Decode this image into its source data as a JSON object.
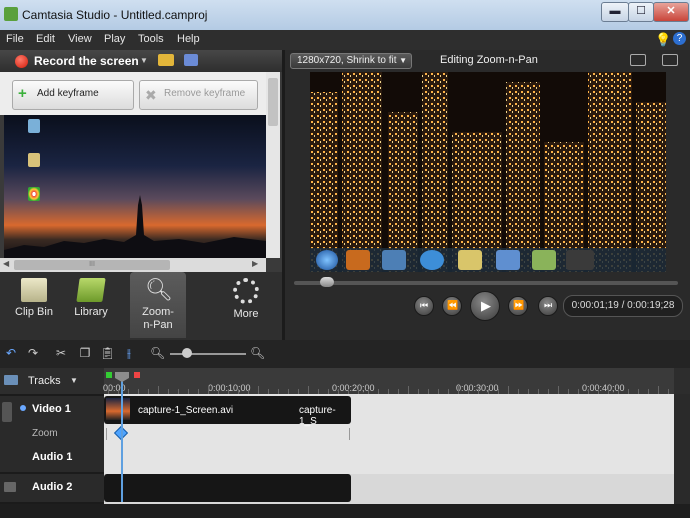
{
  "window": {
    "title": "Camtasia Studio - Untitled.camproj",
    "min_label": "▬",
    "max_label": "☐",
    "close_label": "✕"
  },
  "menu": [
    "File",
    "Edit",
    "View",
    "Play",
    "Tools",
    "Help"
  ],
  "left": {
    "record_label": "Record the screen",
    "add_keyframe": "Add keyframe",
    "remove_keyframe": "Remove keyframe",
    "scroll_grip": "III",
    "tabs": [
      "Clip Bin",
      "Library",
      "Zoom-n-Pan",
      "More"
    ]
  },
  "right": {
    "canvas_size": "1280x720, Shrink to fit",
    "editing_label": "Editing Zoom-n-Pan",
    "timecode": "0:00:01;19 / 0:00:19;28"
  },
  "timeline": {
    "tracks_label": "Tracks",
    "time_labels": [
      "00:00",
      "0:00:10;00",
      "0:00:20;00",
      "0:00:30;00",
      "0:00:40;00"
    ],
    "tracks": [
      "Video 1",
      "Zoom",
      "Audio 1",
      "Audio 2"
    ],
    "clip_name": "capture-1_Screen.avi",
    "clip_name_2": "capture-1_S"
  },
  "colors": {
    "accent": "#4da3ff",
    "record": "#d11a08"
  }
}
